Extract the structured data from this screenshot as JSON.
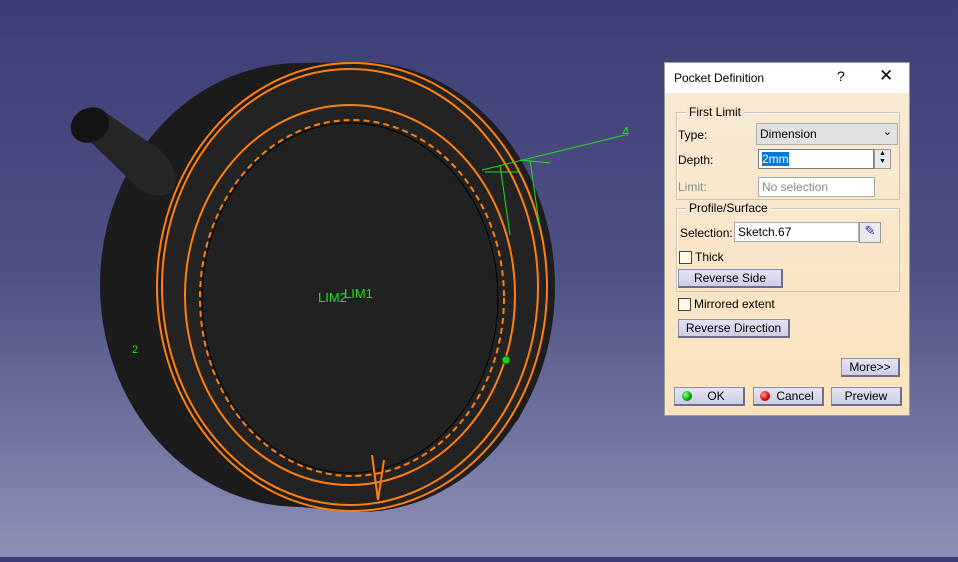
{
  "viewport": {
    "labels": {
      "lim2": "LIM2",
      "lim1": "LIM1",
      "four": "4",
      "two": "2"
    },
    "colors": {
      "edge_highlight": "#ff7f10",
      "construction": "#22dd22",
      "body": "#222222"
    }
  },
  "dialog": {
    "title": "Pocket Definition",
    "help_label": "?",
    "close_label": "✕",
    "first_limit": {
      "group_label": "First Limit",
      "type_label": "Type:",
      "type_value": "Dimension",
      "depth_label": "Depth:",
      "depth_value": "2mm",
      "limit_label": "Limit:",
      "limit_value": "No selection"
    },
    "profile": {
      "group_label": "Profile/Surface",
      "selection_label": "Selection:",
      "selection_value": "Sketch.67",
      "thick_label": "Thick",
      "thick_checked": false,
      "reverse_side_label": "Reverse Side"
    },
    "mirrored_label": "Mirrored extent",
    "mirrored_checked": false,
    "reverse_direction_label": "Reverse Direction",
    "more_label": "More>>",
    "ok_label": "OK",
    "cancel_label": "Cancel",
    "preview_label": "Preview"
  }
}
